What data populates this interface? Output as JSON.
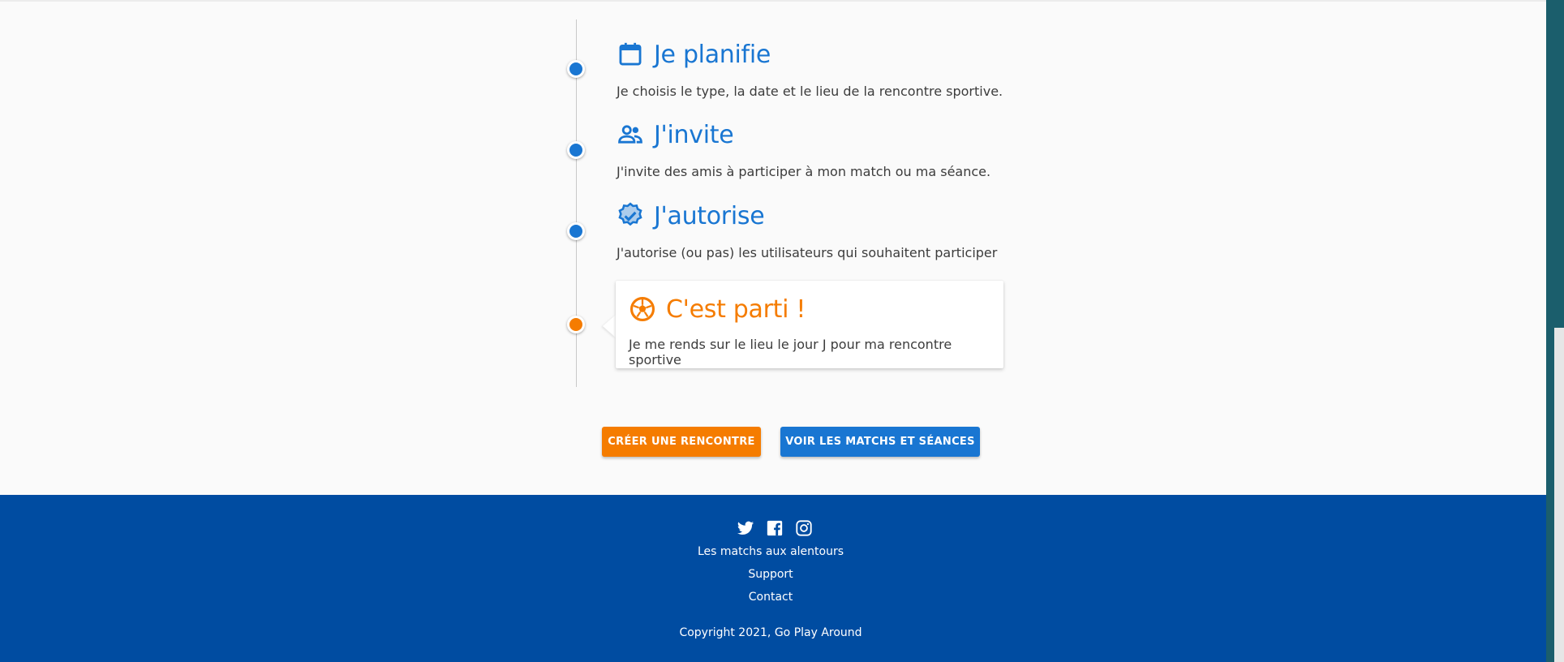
{
  "timeline": {
    "steps": [
      {
        "icon": "calendar-icon",
        "title": "Je planifie",
        "text": "Je choisis le type, la date et le lieu de la rencontre sportive."
      },
      {
        "icon": "people-icon",
        "title": "J'invite",
        "text": "J'invite des amis à participer à mon match ou ma séance."
      },
      {
        "icon": "verified-badge-icon",
        "title": "J'autorise",
        "text": "J'autorise (ou pas) les utilisateurs qui souhaitent participer"
      },
      {
        "icon": "soccer-ball-icon",
        "title": "C'est parti !",
        "text": "Je me rends sur le lieu le jour J pour ma rencontre sportive"
      }
    ]
  },
  "actions": {
    "create_label": "CRÉER UNE RENCONTRE",
    "view_label": "VOIR LES MATCHS ET SÉANCES"
  },
  "footer": {
    "social": [
      "twitter-icon",
      "facebook-icon",
      "instagram-icon"
    ],
    "links": [
      "Les matchs aux alentours",
      "Support",
      "Contact"
    ],
    "copyright": "Copyright 2021, Go Play Around"
  },
  "colors": {
    "primary": "#1976d2",
    "accent": "#f57c00",
    "footer_bg": "#004ca1"
  }
}
